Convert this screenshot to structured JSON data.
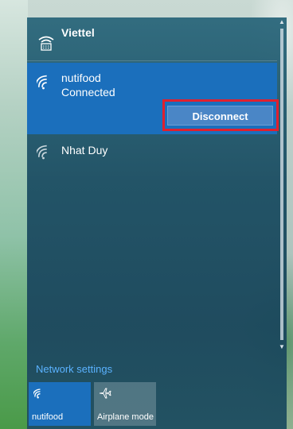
{
  "networks": {
    "viettel": {
      "name": "Viettel",
      "icon": "ethernet-wifi-icon"
    },
    "nutifood": {
      "name": "nutifood",
      "status": "Connected",
      "icon": "wifi-icon",
      "action_label": "Disconnect"
    },
    "nhatduy": {
      "name": "Nhat Duy",
      "icon": "wifi-icon"
    }
  },
  "footer": {
    "settings_link": "Network settings"
  },
  "tiles": [
    {
      "label": "nutifood",
      "icon": "wifi-icon"
    },
    {
      "label": "Airplane mode",
      "icon": "airplane-icon"
    }
  ],
  "colors": {
    "accent": "#1b6fbc",
    "highlight": "#e0202e",
    "link": "#5ab2ff"
  }
}
